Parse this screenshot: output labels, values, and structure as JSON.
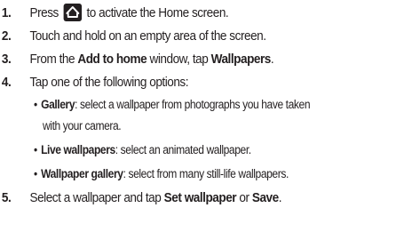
{
  "steps": [
    {
      "number": "1.",
      "before_icon": "Press",
      "icon": "home-key-icon",
      "after_icon": "to activate the Home screen."
    },
    {
      "number": "2.",
      "text": "Touch and hold on an empty area of the screen."
    },
    {
      "number": "3.",
      "pre": "From the ",
      "bold1": "Add to home",
      "mid": " window, tap ",
      "bold2": "Wallpapers",
      "post": "."
    },
    {
      "number": "4.",
      "text": "Tap one of the following options:",
      "options": [
        {
          "name": "Gallery",
          "description": ": select a wallpaper from photographs you have taken",
          "continuation": "with your camera."
        },
        {
          "name": "Live wallpapers",
          "description": ": select an animated wallpaper."
        },
        {
          "name": "Wallpaper gallery",
          "description": ": select from many still-life wallpapers."
        }
      ]
    },
    {
      "number": "5.",
      "pre": "Select a wallpaper and tap ",
      "bold1": "Set wallpaper",
      "mid": " or ",
      "bold2": "Save",
      "post": "."
    }
  ],
  "bullet_char": "•"
}
